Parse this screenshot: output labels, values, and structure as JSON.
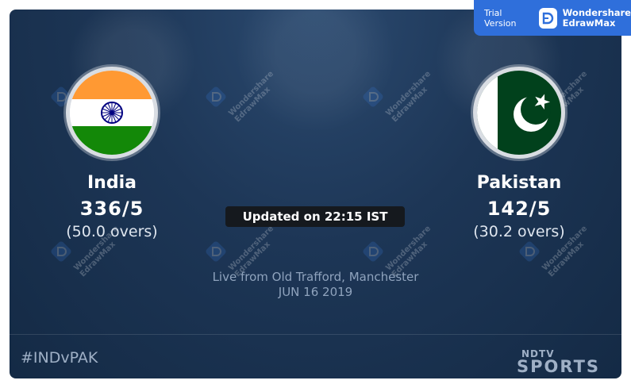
{
  "banner": {
    "trial_label": "Trial Version",
    "brand_line1": "Wondershare",
    "brand_line2": "EdrawMax"
  },
  "teams": [
    {
      "name": "India",
      "score": "336/5",
      "overs": "(50.0 overs)",
      "flag": "india-flag"
    },
    {
      "name": "Pakistan",
      "score": "142/5",
      "overs": "(30.2 overs)",
      "flag": "pakistan-flag"
    }
  ],
  "updated": "Updated on 22:15 IST",
  "venue": {
    "location": "Live from Old Trafford, Manchester",
    "date": "JUN 16 2019"
  },
  "footer": {
    "hashtag": "#INDvPAK",
    "logo_top": "NDTV",
    "logo_bottom": "SPORTS"
  },
  "watermark": {
    "line1": "Wondershare",
    "line2": "EdrawMax"
  },
  "colors": {
    "background": "#1d3656",
    "banner": "#2f6fdb",
    "india_saffron": "#ff9933",
    "india_green": "#138808",
    "pakistan_green": "#01411c"
  }
}
